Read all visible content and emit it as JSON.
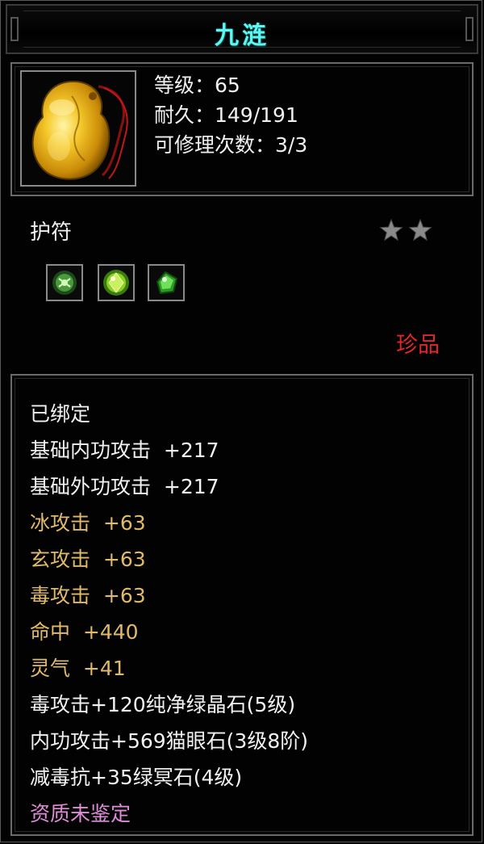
{
  "item": {
    "name": "九涟",
    "level": "等级：65",
    "durability": "耐久：149/191",
    "repairs": "可修理次数：3/3",
    "type": "护符",
    "stars": 2,
    "rarity": "珍品",
    "rarity_color": "#e0282a",
    "gems": [
      "cat-eye-gem-icon",
      "green-crystal-gem-icon",
      "green-jade-gem-icon"
    ]
  },
  "attributes": [
    {
      "text": "已绑定",
      "color": "white"
    },
    {
      "text": "基础内功攻击  +217",
      "color": "white"
    },
    {
      "text": "基础外功攻击  +217",
      "color": "white"
    },
    {
      "text": "冰攻击  +63",
      "color": "gold"
    },
    {
      "text": "玄攻击  +63",
      "color": "gold"
    },
    {
      "text": "毒攻击  +63",
      "color": "gold"
    },
    {
      "text": "命中  +440",
      "color": "gold"
    },
    {
      "text": "灵气  +41",
      "color": "gold"
    },
    {
      "text": "毒攻击+120纯净绿晶石(5级)",
      "color": "white"
    },
    {
      "text": "内功攻击+569猫眼石(3级8阶)",
      "color": "white"
    },
    {
      "text": "减毒抗+35绿冥石(4级)",
      "color": "white"
    },
    {
      "text": "资质未鉴定",
      "color": "pink"
    }
  ],
  "colors": {
    "title": "#5ef6f0",
    "gold": "#e1b96a",
    "pink": "#e08cd8",
    "white": "#f2f2f2"
  }
}
